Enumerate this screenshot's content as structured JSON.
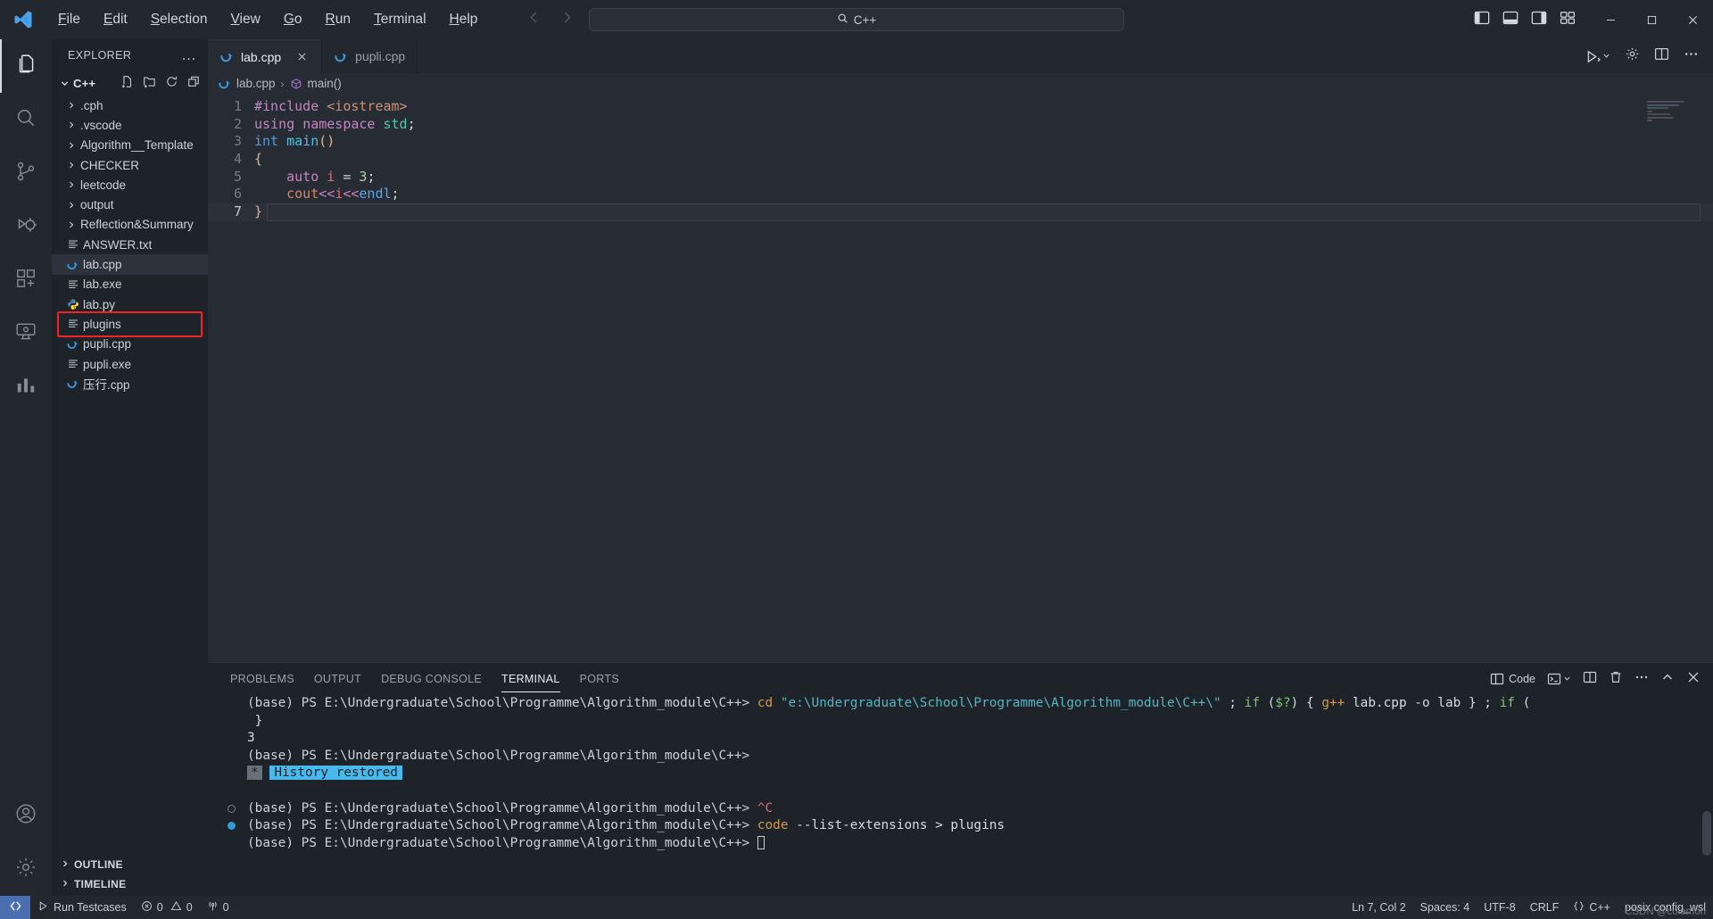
{
  "titlebar": {
    "logo_icon": "vscode-logo",
    "menus": [
      {
        "label": "File",
        "mn": "F"
      },
      {
        "label": "Edit",
        "mn": "E"
      },
      {
        "label": "Selection",
        "mn": "S"
      },
      {
        "label": "View",
        "mn": "V"
      },
      {
        "label": "Go",
        "mn": "G"
      },
      {
        "label": "Run",
        "mn": "R"
      },
      {
        "label": "Terminal",
        "mn": "T"
      },
      {
        "label": "Help",
        "mn": "H"
      }
    ],
    "back_icon": "arrow-left-icon",
    "forward_icon": "arrow-right-icon",
    "search": {
      "value": "C++",
      "icon": "search-icon"
    },
    "layout_icons": [
      "toggle-primary-sidebar-icon",
      "toggle-panel-icon",
      "toggle-secondary-sidebar-icon",
      "customize-layout-icon"
    ],
    "window": {
      "minimize": "minimize-icon",
      "maximize": "maximize-icon",
      "close": "close-icon"
    }
  },
  "activitybar": {
    "items": [
      {
        "name": "explorer",
        "icon": "files-icon",
        "active": true
      },
      {
        "name": "search",
        "icon": "search-icon",
        "active": false
      },
      {
        "name": "source-control",
        "icon": "source-control-icon",
        "active": false
      },
      {
        "name": "run-and-debug",
        "icon": "debug-icon",
        "active": false
      },
      {
        "name": "extensions",
        "icon": "extensions-icon",
        "active": false
      },
      {
        "name": "remote-explorer",
        "icon": "remote-explorer-icon",
        "active": false
      },
      {
        "name": "testing-chart",
        "icon": "bar-chart-icon",
        "active": false
      }
    ],
    "bottom": [
      {
        "name": "accounts",
        "icon": "account-icon"
      },
      {
        "name": "manage",
        "icon": "gear-icon"
      }
    ]
  },
  "sidebar": {
    "title": "EXPLORER",
    "more_actions": "…",
    "root": {
      "label": "C++",
      "expanded": true,
      "actions": [
        "new-file-icon",
        "new-folder-icon",
        "refresh-icon",
        "collapse-all-icon"
      ]
    },
    "tree": [
      {
        "label": ".cph",
        "type": "folder",
        "icon": "chevron-right-icon",
        "indent": 0
      },
      {
        "label": ".vscode",
        "type": "folder",
        "icon": "chevron-right-icon",
        "indent": 0
      },
      {
        "label": "Algorithm__Template",
        "type": "folder",
        "icon": "chevron-right-icon",
        "indent": 0
      },
      {
        "label": "CHECKER",
        "type": "folder",
        "icon": "chevron-right-icon",
        "indent": 0
      },
      {
        "label": "leetcode",
        "type": "folder",
        "icon": "chevron-right-icon",
        "indent": 0
      },
      {
        "label": "output",
        "type": "folder",
        "icon": "chevron-right-icon",
        "indent": 0
      },
      {
        "label": "Reflection&Summary",
        "type": "folder",
        "icon": "chevron-right-icon",
        "indent": 0
      },
      {
        "label": "ANSWER.txt",
        "type": "file",
        "icon": "text-file-icon",
        "indent": 1
      },
      {
        "label": "lab.cpp",
        "type": "file",
        "icon": "cpp-file-icon",
        "indent": 1,
        "selected": true
      },
      {
        "label": "lab.exe",
        "type": "file",
        "icon": "text-file-icon",
        "indent": 1
      },
      {
        "label": "lab.py",
        "type": "file",
        "icon": "python-file-icon",
        "indent": 1
      },
      {
        "label": "plugins",
        "type": "file",
        "icon": "text-file-icon",
        "indent": 1,
        "annotated": true
      },
      {
        "label": "pupli.cpp",
        "type": "file",
        "icon": "cpp-file-icon",
        "indent": 1
      },
      {
        "label": "pupli.exe",
        "type": "file",
        "icon": "text-file-icon",
        "indent": 1
      },
      {
        "label": "压行.cpp",
        "type": "file",
        "icon": "cpp-file-icon",
        "indent": 1
      }
    ],
    "sections": [
      {
        "label": "OUTLINE",
        "icon": "chevron-right-icon"
      },
      {
        "label": "TIMELINE",
        "icon": "chevron-right-icon"
      }
    ]
  },
  "editor": {
    "tabs": [
      {
        "label": "lab.cpp",
        "icon": "cpp-file-icon",
        "active": true,
        "close_icon": "close-icon"
      },
      {
        "label": "pupli.cpp",
        "icon": "cpp-file-icon",
        "active": false,
        "close_icon": "close-icon"
      }
    ],
    "actions": [
      "run-code-icon",
      "chevron-down-icon",
      "settings-gear-icon",
      "split-editor-icon",
      "more-actions-icon"
    ],
    "breadcrumb": [
      {
        "label": "lab.cpp",
        "icon": "cpp-file-icon"
      },
      {
        "label": "main()",
        "icon": "symbol-method-icon"
      }
    ],
    "breadcrumb_separator": "›",
    "lines": [
      {
        "n": "1",
        "tokens": [
          {
            "t": "#include ",
            "c": "tok-pp"
          },
          {
            "t": "<iostream>",
            "c": "tok-inc"
          }
        ]
      },
      {
        "n": "2",
        "tokens": [
          {
            "t": "using ",
            "c": "tok-kw"
          },
          {
            "t": "namespace ",
            "c": "tok-kw"
          },
          {
            "t": "std",
            "c": "tok-ns"
          },
          {
            "t": ";",
            "c": "tok-punc"
          }
        ]
      },
      {
        "n": "3",
        "tokens": [
          {
            "t": "int ",
            "c": "tok-type"
          },
          {
            "t": "main",
            "c": "tok-fn"
          },
          {
            "t": "()",
            "c": "tok-brace1"
          }
        ]
      },
      {
        "n": "4",
        "tokens": [
          {
            "t": "{",
            "c": "tok-brace1"
          }
        ]
      },
      {
        "n": "5",
        "tokens": [
          {
            "t": "    ",
            "c": "indent-guide"
          },
          {
            "t": "auto ",
            "c": "tok-kw"
          },
          {
            "t": "i ",
            "c": "tok-var"
          },
          {
            "t": "= ",
            "c": "tok-punc"
          },
          {
            "t": "3",
            "c": "tok-num"
          },
          {
            "t": ";",
            "c": "tok-punc"
          }
        ]
      },
      {
        "n": "6",
        "tokens": [
          {
            "t": "    ",
            "c": "indent-guide"
          },
          {
            "t": "cout",
            "c": "tok-cout"
          },
          {
            "t": "<<",
            "c": "tok-op"
          },
          {
            "t": "i",
            "c": "tok-var"
          },
          {
            "t": "<<",
            "c": "tok-op"
          },
          {
            "t": "endl",
            "c": "tok-endl"
          },
          {
            "t": ";",
            "c": "tok-punc"
          }
        ]
      },
      {
        "n": "7",
        "tokens": [
          {
            "t": "}",
            "c": "tok-brace1"
          }
        ],
        "current": true
      }
    ]
  },
  "panel": {
    "tabs": [
      {
        "label": "PROBLEMS",
        "active": false
      },
      {
        "label": "OUTPUT",
        "active": false
      },
      {
        "label": "DEBUG CONSOLE",
        "active": false
      },
      {
        "label": "TERMINAL",
        "active": true
      },
      {
        "label": "PORTS",
        "active": false
      }
    ],
    "actions": {
      "code_label": "Code",
      "code_icon": "terminal-split-icon",
      "new_terminal_icon": "new-terminal-icon",
      "chevron_icon": "chevron-down-icon",
      "split_icon": "split-terminal-icon",
      "kill_icon": "trash-icon",
      "more_icon": "more-actions-icon",
      "maximize_icon": "chevron-up-icon",
      "close_icon": "close-icon"
    },
    "terminal": {
      "prompt": "(base) PS E:\\Undergraduate\\School\\Programme\\Algorithm_module\\C++>",
      "lines": [
        {
          "deco": "none",
          "parts": [
            {
              "t": "(base) PS E:\\Undergraduate\\School\\Programme\\Algorithm_module\\C++> ",
              "c": "t-path"
            },
            {
              "t": "cd ",
              "c": "t-cmd"
            },
            {
              "t": "\"e:\\Undergraduate\\School\\Programme\\Algorithm_module\\C++\\\"",
              "c": "t-str"
            },
            {
              "t": " ; ",
              "c": "t-white"
            },
            {
              "t": "if ",
              "c": "t-grn"
            },
            {
              "t": "(",
              "c": "t-white"
            },
            {
              "t": "$?",
              "c": "t-grn"
            },
            {
              "t": ") { ",
              "c": "t-white"
            },
            {
              "t": "g++",
              "c": "t-cmd"
            },
            {
              "t": " lab.cpp -o lab } ; ",
              "c": "t-white"
            },
            {
              "t": "if ",
              "c": "t-grn"
            },
            {
              "t": "(",
              "c": "t-white"
            }
          ]
        },
        {
          "deco": "none",
          "parts": [
            {
              "t": " }",
              "c": "t-white"
            }
          ]
        },
        {
          "deco": "none",
          "parts": [
            {
              "t": "3",
              "c": "t-white"
            }
          ]
        },
        {
          "deco": "none",
          "parts": [
            {
              "t": "(base) PS E:\\Undergraduate\\School\\Programme\\Algorithm_module\\C++>",
              "c": "t-path"
            }
          ]
        },
        {
          "deco": "none",
          "highlight": true,
          "star": "*",
          "hist": "History restored"
        },
        {
          "deco": "none",
          "parts": []
        },
        {
          "deco": "gray",
          "parts": [
            {
              "t": "(base) PS E:\\Undergraduate\\School\\Programme\\Algorithm_module\\C++> ",
              "c": "t-path"
            },
            {
              "t": "^C",
              "c": "t-red"
            }
          ]
        },
        {
          "deco": "blue",
          "parts": [
            {
              "t": "(base) PS E:\\Undergraduate\\School\\Programme\\Algorithm_module\\C++> ",
              "c": "t-path"
            },
            {
              "t": "code ",
              "c": "t-cmd"
            },
            {
              "t": "--list-extensions > plugins",
              "c": "t-white"
            }
          ]
        },
        {
          "deco": "none",
          "cursor": true,
          "parts": [
            {
              "t": "(base) PS E:\\Undergraduate\\School\\Programme\\Algorithm_module\\C++> ",
              "c": "t-path"
            }
          ]
        }
      ]
    }
  },
  "statusbar": {
    "remote_icon": "remote-window-icon",
    "left": [
      {
        "label": "Run Testcases",
        "icon": "play-icon"
      },
      {
        "label": "0",
        "icon": "error-icon",
        "extra_label": "0",
        "extra_icon": "warning-icon"
      },
      {
        "label": "0",
        "icon": "radio-tower-icon"
      }
    ],
    "right": [
      {
        "label": "Ln 7, Col 2",
        "name": "cursor-position"
      },
      {
        "label": "Spaces: 4",
        "name": "indentation"
      },
      {
        "label": "UTF-8",
        "name": "encoding"
      },
      {
        "label": "CRLF",
        "name": "eol"
      },
      {
        "label": "C++",
        "name": "language-mode",
        "icon": "braces-icon"
      },
      {
        "label": "posix config_wsl",
        "name": "posix-config"
      }
    ]
  },
  "watermark": "CSDN @colemon"
}
